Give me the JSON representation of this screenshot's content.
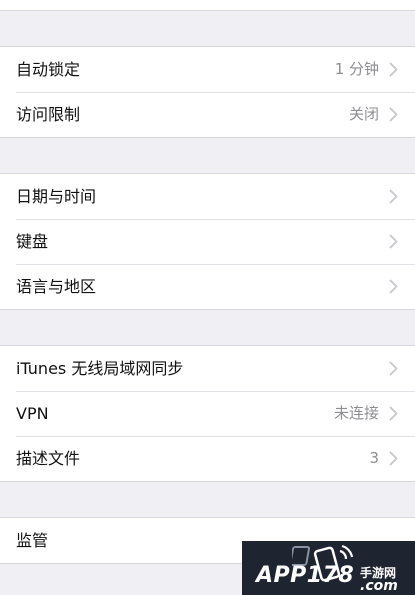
{
  "groups": [
    {
      "rows": [
        {
          "label": "自动锁定",
          "value": "1 分钟"
        },
        {
          "label": "访问限制",
          "value": "关闭"
        }
      ]
    },
    {
      "rows": [
        {
          "label": "日期与时间",
          "value": ""
        },
        {
          "label": "键盘",
          "value": ""
        },
        {
          "label": "语言与地区",
          "value": ""
        }
      ]
    },
    {
      "rows": [
        {
          "label": "iTunes 无线局域网同步",
          "value": ""
        },
        {
          "label": "VPN",
          "value": "未连接"
        },
        {
          "label": "描述文件",
          "value": "3"
        }
      ]
    },
    {
      "rows": [
        {
          "label": "监管",
          "value": ""
        }
      ]
    }
  ],
  "watermark": {
    "brand": "APP178",
    "site_cn": "手游网",
    "domain": ".com"
  },
  "colors": {
    "background": "#efeff4",
    "cell": "#ffffff",
    "label": "#111111",
    "value": "#8e8e93",
    "chevron": "#c7c7cc"
  },
  "icons": {
    "row_accessory": "chevron-right-icon",
    "watermark_logo": "phone-signal-icon"
  }
}
